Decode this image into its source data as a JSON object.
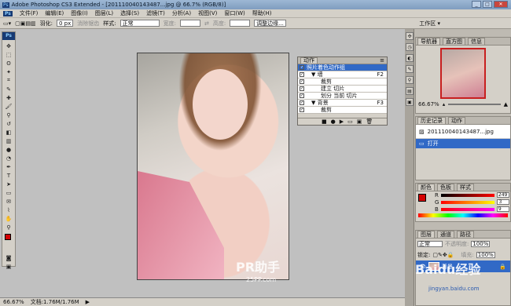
{
  "app": {
    "title": "Adobe Photoshop CS3 Extended - [201110040143487...jpg @ 66.7% (RGB/8)]",
    "logo": "Ps"
  },
  "window_buttons": [
    "_",
    "□",
    "✕"
  ],
  "menu": [
    "文件(F)",
    "编辑(E)",
    "图像(I)",
    "图层(L)",
    "选择(S)",
    "滤镜(T)",
    "分析(A)",
    "视图(V)",
    "窗口(W)",
    "帮助(H)"
  ],
  "options": {
    "feather_label": "羽化:",
    "feather_value": "0 px",
    "antialias": "消除锯齿",
    "style_label": "样式:",
    "style_value": "正常",
    "width_label": "宽度:",
    "height_label": "高度:",
    "refine": "调整边缘...",
    "workspace": "工作区 ▾"
  },
  "actions_panel": {
    "tab": "动作",
    "rows": [
      {
        "check": "✓",
        "indent": 0,
        "label": "照片着色动作组",
        "key": "",
        "sel": true
      },
      {
        "check": "✓",
        "indent": 1,
        "label": "▼ 墙",
        "key": "F2",
        "sel": false
      },
      {
        "check": "✓",
        "indent": 2,
        "label": "裁剪",
        "key": "",
        "sel": false
      },
      {
        "check": "✓",
        "indent": 2,
        "label": "建立 切片",
        "key": "",
        "sel": false
      },
      {
        "check": "✓",
        "indent": 2,
        "label": "划分 当前 切片",
        "key": "",
        "sel": false
      },
      {
        "check": "✓",
        "indent": 1,
        "label": "▼ 背景",
        "key": "F3",
        "sel": false
      },
      {
        "check": "✓",
        "indent": 2,
        "label": "裁剪",
        "key": "",
        "sel": false
      },
      {
        "check": "✓",
        "indent": 2,
        "label": "建立 切片",
        "key": "",
        "sel": false
      }
    ]
  },
  "navigator": {
    "tabs": [
      "导航器",
      "直方图",
      "信息"
    ],
    "zoom": "66.67%"
  },
  "history": {
    "tabs": [
      "历史记录",
      "动作"
    ],
    "snapshot": "201110040143487...jpg",
    "item": "打开"
  },
  "color_panel": {
    "tabs": [
      "颜色",
      "色板",
      "样式"
    ],
    "channels": [
      {
        "label": "R",
        "value": "249"
      },
      {
        "label": "G",
        "value": "3"
      },
      {
        "label": "B",
        "value": "9"
      }
    ]
  },
  "layers": {
    "tabs": [
      "图层",
      "通道",
      "路径"
    ],
    "blend": "正常",
    "opacity_label": "不透明度:",
    "opacity": "100%",
    "lock_label": "锁定:",
    "fill_label": "填充:",
    "fill": "100%",
    "layer_name": "背景"
  },
  "status": {
    "zoom": "66.67%",
    "doc": "文档:1.76M/1.76M"
  },
  "watermarks": {
    "pr": "PR助手",
    "site": "25PP.com",
    "baidu": "Baidu经验",
    "url": "jingyan.baidu.com"
  },
  "colors": {
    "fg": "#d40000",
    "bg": "#ffffff",
    "selection": "#3169c6"
  }
}
